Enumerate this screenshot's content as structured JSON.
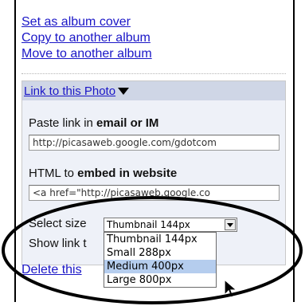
{
  "top_links": [
    "Set as album cover",
    "Copy to another album",
    "Move to another album"
  ],
  "section": {
    "title": "Link to this Photo",
    "paste_label_prefix": "Paste link in ",
    "paste_label_bold": "email or IM",
    "paste_value": "http://picasaweb.google.com/gdotcom",
    "html_label_prefix": "HTML to ",
    "html_label_bold": "embed in website",
    "html_value": "<a href=\"http://picasaweb.google.co",
    "select_size_label": "Select size",
    "select_value": "Thumbnail 144px",
    "show_link_label": "Show link t"
  },
  "dropdown_options": [
    "Thumbnail 144px",
    "Small 288px",
    "Medium 400px",
    "Large 800px"
  ],
  "dropdown_highlighted": "Medium 400px",
  "delete_label": "Delete this"
}
